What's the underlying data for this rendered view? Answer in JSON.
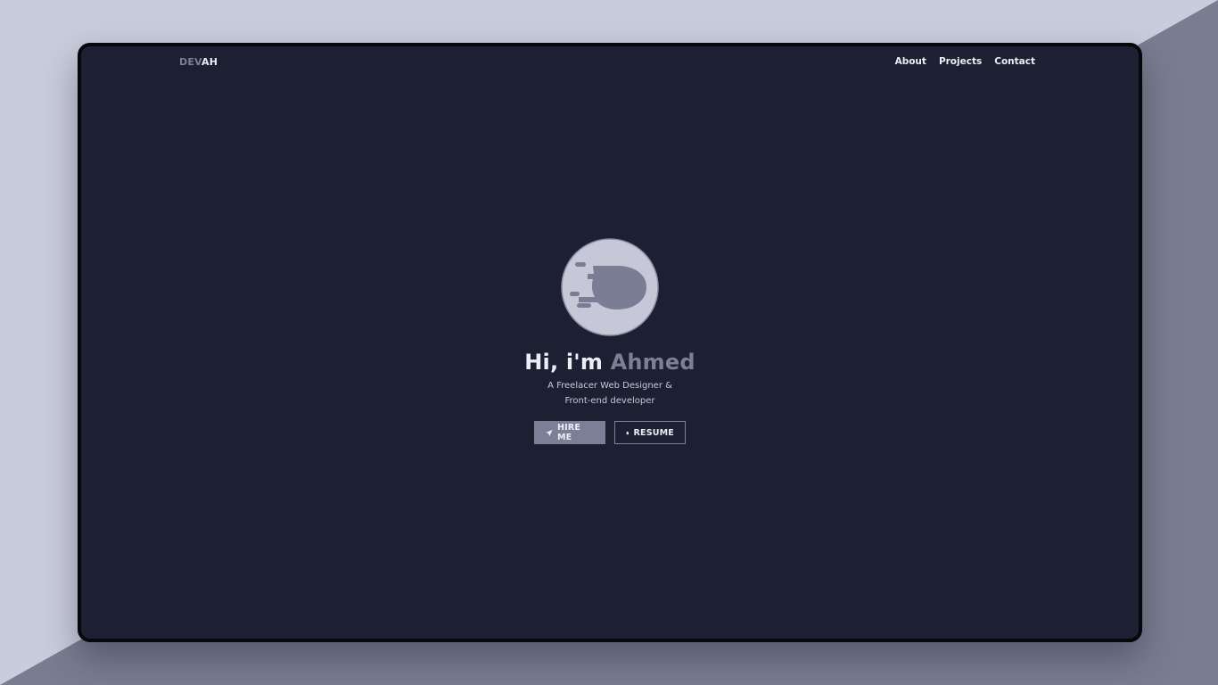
{
  "nav": {
    "logo_part1": "DEV",
    "logo_part2": "AH",
    "links": [
      "About",
      "Projects",
      "Contact"
    ]
  },
  "hero": {
    "greeting": "Hi, i'm ",
    "name": "Ahmed",
    "subtitle_line1": "A Freelacer Web Designer &",
    "subtitle_line2": "Front-end developer",
    "hire_label": "HIRE ME",
    "resume_label": "RESUME"
  },
  "icons": {
    "avatar": "comet-logo-icon",
    "hire": "paper-plane-icon",
    "resume": "document-icon"
  },
  "colors": {
    "page_background": "#c9ccdc",
    "background_shadow": "#7a7d90",
    "frame_background": "#1d2032",
    "accent": "#7c7f96",
    "text_primary": "#eceef6",
    "avatar_fill": "#c6c8d8"
  }
}
